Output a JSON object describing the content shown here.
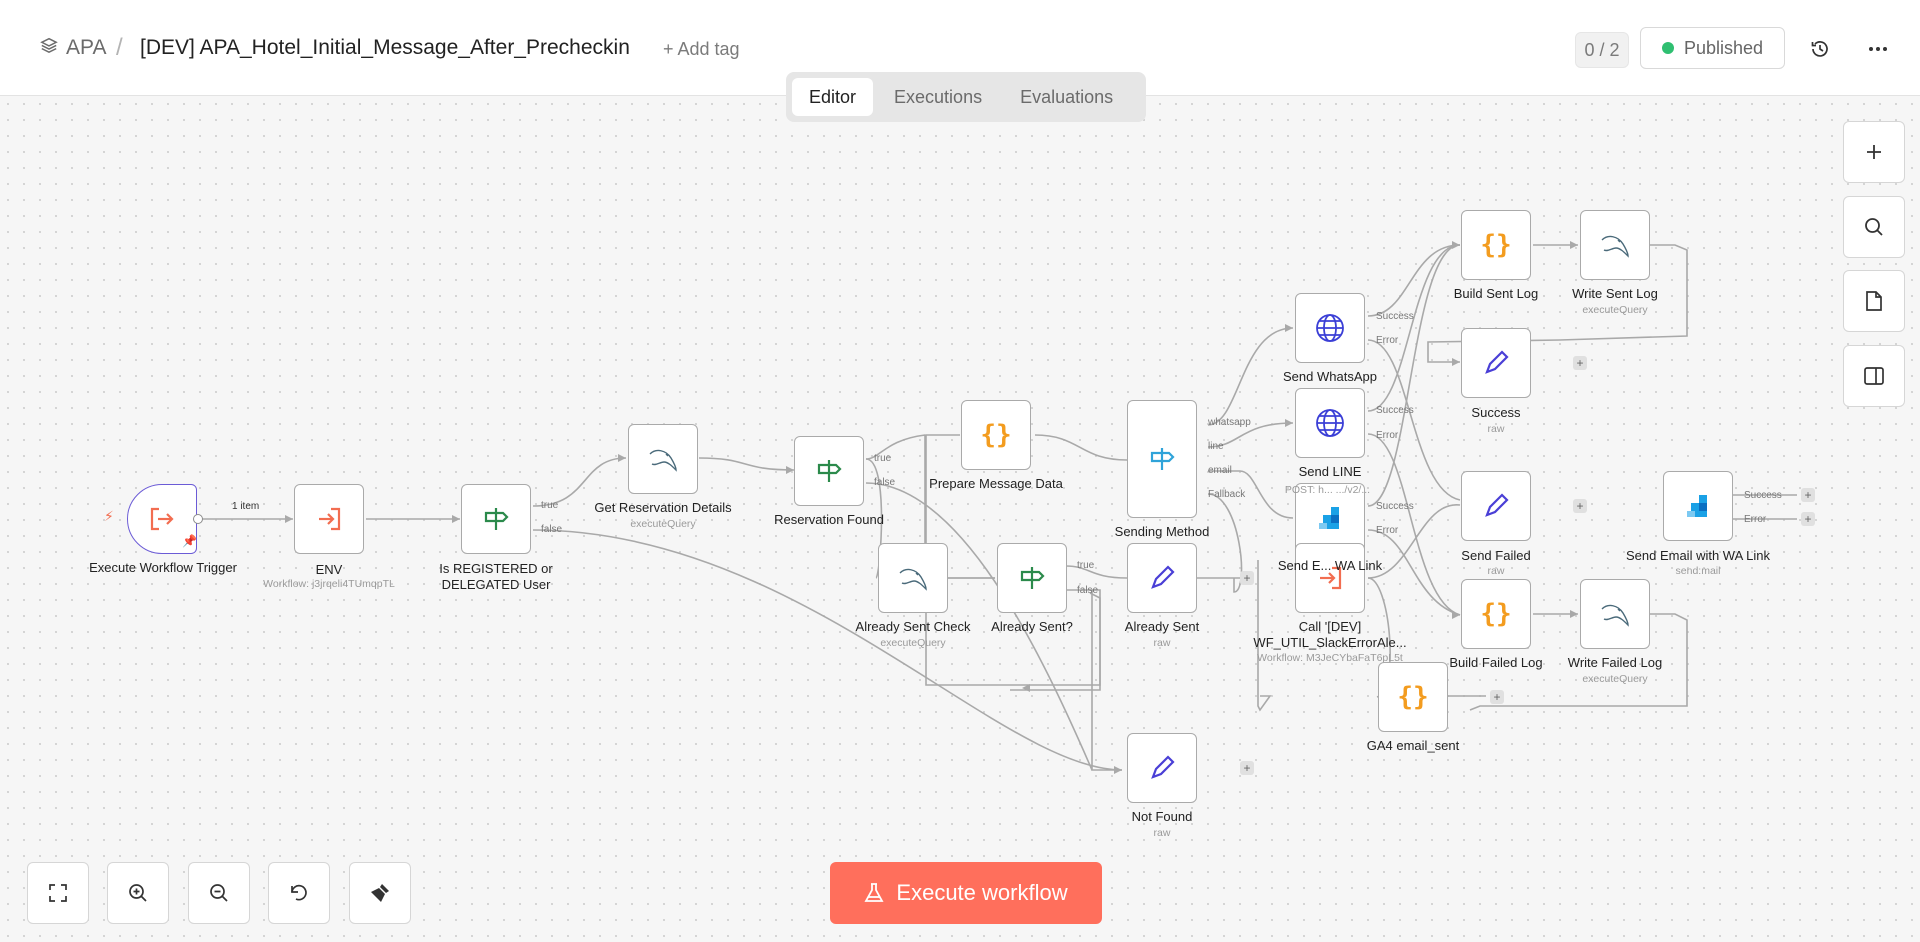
{
  "header": {
    "project": "APA",
    "separator": "/",
    "title": "[DEV] APA_Hotel_Initial_Message_After_Precheckin",
    "add_tag": "+ Add tag",
    "counter": "0 / 2",
    "status": "Published",
    "status_color": "#2fbf71"
  },
  "tabs": [
    "Editor",
    "Executions",
    "Evaluations"
  ],
  "active_tab": "Editor",
  "edge_labels": {
    "item_count": "1 item"
  },
  "nodes": {
    "execute_trigger": {
      "label": "Execute Workflow Trigger",
      "sub": ""
    },
    "env": {
      "label": "ENV",
      "sub": "Workflow: j3jrqeli4TUmqpTL"
    },
    "is_registered": {
      "label": "Is REGISTERED or DELEGATED User",
      "sub": ""
    },
    "get_reservation": {
      "label": "Get Reservation Details",
      "sub": "executeQuery"
    },
    "reservation_found": {
      "label": "Reservation Found",
      "sub": ""
    },
    "prepare_message": {
      "label": "Prepare Message Data",
      "sub": ""
    },
    "already_sent_check": {
      "label": "Already Sent Check",
      "sub": "executeQuery"
    },
    "already_sent_q": {
      "label": "Already Sent?",
      "sub": ""
    },
    "sending_method": {
      "label": "Sending Method",
      "sub": ""
    },
    "already_sent": {
      "label": "Already Sent",
      "sub": "raw"
    },
    "not_found": {
      "label": "Not Found",
      "sub": "raw"
    },
    "send_whatsapp": {
      "label": "Send WhatsApp",
      "sub": ""
    },
    "send_line": {
      "label": "Send LINE",
      "sub": ""
    },
    "send_email_mid": {
      "label": "Send E... WA Link",
      "sub": "POST: h... .../v2/..."
    },
    "call_dev": {
      "label": "Call '[DEV] WF_UTIL_SlackErrorAle...",
      "sub": "Workflow: M3JeCYbaFaT6pL5t"
    },
    "build_sent_log": {
      "label": "Build Sent Log",
      "sub": ""
    },
    "write_sent_log": {
      "label": "Write Sent Log",
      "sub": "executeQuery"
    },
    "success": {
      "label": "Success",
      "sub": "raw"
    },
    "send_failed": {
      "label": "Send Failed",
      "sub": "raw"
    },
    "build_failed_log": {
      "label": "Build Failed Log",
      "sub": ""
    },
    "write_failed_log": {
      "label": "Write Failed Log",
      "sub": "executeQuery"
    },
    "ga4_email_sent": {
      "label": "GA4 email_sent",
      "sub": ""
    },
    "send_email_wa": {
      "label": "Send Email with WA Link",
      "sub": "send:mail"
    }
  },
  "ports": {
    "true": "true",
    "false": "false",
    "whatsapp": "whatsapp",
    "line": "line",
    "email": "email",
    "fallback": "Fallback",
    "success": "Success",
    "error": "Error"
  },
  "bottom": {
    "execute": "Execute workflow",
    "execute_color": "#ff6f5c"
  },
  "icons": {
    "toolbar_right": [
      "plus-icon",
      "search-icon",
      "sticky-note-icon",
      "panel-icon"
    ],
    "toolbar_bottom": [
      "fit-view-icon",
      "zoom-in-icon",
      "zoom-out-icon",
      "reset-zoom-icon",
      "tidy-up-icon"
    ]
  }
}
